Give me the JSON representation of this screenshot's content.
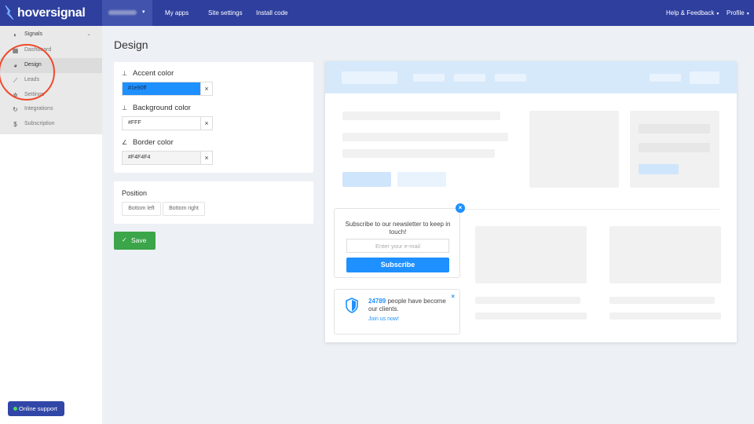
{
  "brand": {
    "name": "hoversignal",
    "accent": "#1e90ff",
    "nav_bg": "#2e3f9e"
  },
  "topbar": {
    "site_selector": {
      "caret": "▾"
    },
    "links": [
      "My apps",
      "Site settings",
      "Install code"
    ],
    "help": "Help & Feedback",
    "profile": "Profile"
  },
  "sidebar": {
    "parent": {
      "label": "Signals",
      "icon": "signals-icon"
    },
    "items": [
      {
        "label": "Dashboard",
        "icon": "grid-icon"
      },
      {
        "label": "Design",
        "icon": "palette-icon",
        "active": true
      },
      {
        "label": "Leads",
        "icon": "chart-icon"
      },
      {
        "label": "Settings",
        "icon": "gear-icon"
      },
      {
        "label": "Integrations",
        "icon": "sync-icon"
      },
      {
        "label": "Subscription",
        "icon": "dollar-icon"
      }
    ],
    "online_support": "Online support"
  },
  "page": {
    "title": "Design"
  },
  "colors": {
    "accent": {
      "label": "Accent color",
      "value": "#1e90ff",
      "display": "#1e90ff"
    },
    "background": {
      "label": "Background color",
      "value": "#FFF",
      "display": "#FFF"
    },
    "border": {
      "label": "Border color",
      "value": "#F4F4F4",
      "display": "#F4F4F4"
    },
    "clear_symbol": "×"
  },
  "position": {
    "label": "Position",
    "options": [
      "Bottom left",
      "Bottom right"
    ]
  },
  "save": {
    "label": "Save",
    "check": "✓"
  },
  "widget_subscribe": {
    "text": "Subscribe to our newsletter to keep in touch!",
    "placeholder": "Enter your e-mail",
    "button": "Subscribe",
    "close": "×"
  },
  "widget_counter": {
    "count": "24789",
    "text": "people have become our clients.",
    "link": "Join us now!",
    "close": "×"
  }
}
